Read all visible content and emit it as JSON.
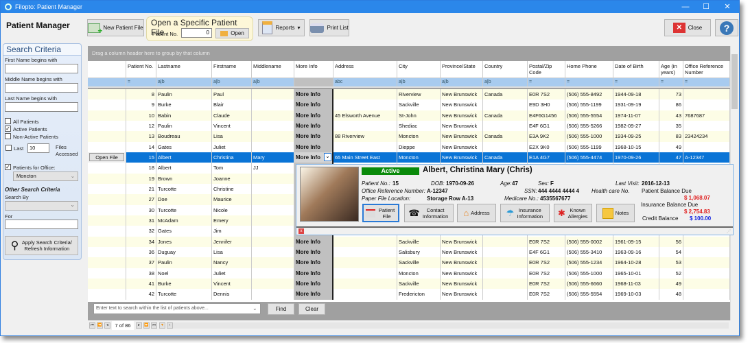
{
  "window": {
    "title": "Filopto: Patient Manager",
    "minimize": "—",
    "maximize": "☐",
    "close": "✕"
  },
  "app_title": "Patient Manager",
  "toolbar": {
    "new_patient": "New Patient File",
    "open_box_title": "Open a Specific Patient File",
    "patient_no_label": "Patient No.",
    "patient_no_value": "0",
    "open": "Open",
    "reports": "Reports",
    "print_list": "Print List",
    "close": "Close",
    "help": "?"
  },
  "search": {
    "title": "Search Criteria",
    "first_name": "First Name begins with",
    "middle_name": "Middle Name begins with",
    "last_name": "Last Name begins with",
    "all_patients": "All Patients",
    "active_patients": "Active Patients",
    "non_active": "Non-Active Patients",
    "last": "Last",
    "last_value": "10",
    "files_accessed": "Files Accessed",
    "patients_for_office": "Patients for Office:",
    "office_value": "Moncton",
    "other": "Other Search Criteria",
    "search_by": "Search By",
    "for": "For",
    "apply": "Apply Search Criteria/ Refresh Information",
    "checked": {
      "all": false,
      "active": true,
      "non_active": false,
      "last": false,
      "office": true
    }
  },
  "grid": {
    "group_hint": "Drag a column header here to group by that column",
    "columns": [
      "",
      "Patient No.",
      "Lastname",
      "Firstname",
      "Middlename",
      "More Info",
      "Address",
      "City",
      "Province/State",
      "Country",
      "Postal/Zip Code",
      "Home Phone",
      "Date of Birth",
      "Age (in years)",
      "Office Reference Number"
    ],
    "filters": [
      "",
      "=",
      "a|b",
      "a|b",
      "a|b",
      "",
      "abc",
      "a|b",
      "a|b",
      "a|b",
      "=",
      "=",
      "=",
      "=",
      "="
    ],
    "open_file": "Open File",
    "selected_row": 6,
    "rows": [
      [
        "8",
        "Paulin",
        "Paul",
        "",
        "More Info",
        "",
        "Riverview",
        "New Brunswick",
        "Canada",
        "E0R 7S2",
        "(506) 555-8492",
        "1944-09-18",
        "73",
        ""
      ],
      [
        "9",
        "Burke",
        "Blair",
        "",
        "More Info",
        "",
        "Sackville",
        "New Brunswick",
        "",
        "E9D 3H0",
        "(506) 555-1199",
        "1931-09-19",
        "86",
        ""
      ],
      [
        "10",
        "Babin",
        "Claude",
        "",
        "More Info",
        "45 Elsworth Avenue",
        "St-John",
        "New Brunswick",
        "Canada",
        "E4F6G1456",
        "(506) 555-5554",
        "1974-11-07",
        "43",
        "7687687"
      ],
      [
        "12",
        "Paulin",
        "Vincent",
        "",
        "More Info",
        "",
        "Shediac",
        "New Brunswick",
        "",
        "E4F 6G1",
        "(506) 555-5266",
        "1982-09-27",
        "35",
        ""
      ],
      [
        "13",
        "Boudreau",
        "Lisa",
        "",
        "More Info",
        "88 Riverview",
        "Moncton",
        "New Brunswick",
        "Canada",
        "E3A 9K2",
        "(506) 555-1000",
        "1934-09-25",
        "83",
        "23424234"
      ],
      [
        "14",
        "Gates",
        "Juliet",
        "",
        "More Info",
        "",
        "Dieppe",
        "New Brunswick",
        "",
        "E2X 9K0",
        "(506) 555-1199",
        "1968-10-15",
        "49",
        ""
      ],
      [
        "15",
        "Albert",
        "Christina",
        "Mary",
        "More Info",
        "65 Main Street East",
        "Moncton",
        "New Brunswick",
        "Canada",
        "E1A 4G7",
        "(506) 555-4474",
        "1970-09-26",
        "47",
        "A-12347"
      ],
      [
        "18",
        "Albert",
        "Tom",
        "JJ",
        "",
        "",
        "",
        "",
        "",
        "",
        "",
        "",
        "",
        ""
      ],
      [
        "19",
        "Brown",
        "Joanne",
        "",
        "",
        "",
        "",
        "",
        "",
        "",
        "",
        "",
        "",
        ""
      ],
      [
        "21",
        "Turcotte",
        "Christine",
        "",
        "",
        "",
        "",
        "",
        "",
        "",
        "",
        "",
        "",
        ""
      ],
      [
        "27",
        "Doe",
        "Maurice",
        "",
        "",
        "",
        "",
        "",
        "",
        "",
        "",
        "",
        "",
        ""
      ],
      [
        "30",
        "Turcotte",
        "Nicole",
        "",
        "",
        "",
        "",
        "",
        "",
        "",
        "",
        "",
        "",
        ""
      ],
      [
        "31",
        "McAdam",
        "Emery",
        "",
        "",
        "",
        "",
        "",
        "",
        "",
        "",
        "",
        "",
        ""
      ],
      [
        "32",
        "Gates",
        "Jim",
        "",
        "",
        "",
        "",
        "",
        "",
        "",
        "",
        "",
        "",
        ""
      ],
      [
        "34",
        "Jones",
        "Jennifer",
        "",
        "More Info",
        "",
        "Sackville",
        "New Brunswick",
        "",
        "E0R 7S2",
        "(506) 555-0002",
        "1961-09-15",
        "56",
        ""
      ],
      [
        "36",
        "Duguay",
        "Lisa",
        "",
        "More Info",
        "",
        "Salisbury",
        "New Brunswick",
        "",
        "E4F 6G1",
        "(506) 555-3410",
        "1963-09-16",
        "54",
        ""
      ],
      [
        "37",
        "Paulin",
        "Nancy",
        "",
        "More Info",
        "",
        "Sackville",
        "New Brunswick",
        "",
        "E0R 7S2",
        "(506) 555-1234",
        "1964-10-28",
        "53",
        ""
      ],
      [
        "38",
        "Noel",
        "Juliet",
        "",
        "More Info",
        "",
        "Moncton",
        "New Brunswick",
        "",
        "E0R 7S2",
        "(506) 555-1000",
        "1965-10-01",
        "52",
        ""
      ],
      [
        "41",
        "Burke",
        "Vincent",
        "",
        "More Info",
        "",
        "Sackville",
        "New Brunswick",
        "",
        "E0R 7S2",
        "(506) 555-6660",
        "1968-11-03",
        "49",
        ""
      ],
      [
        "42",
        "Turcotte",
        "Dennis",
        "",
        "More Info",
        "",
        "Fredericton",
        "New Brunswick",
        "",
        "E0R 7S2",
        "(506) 555-5554",
        "1969-10-03",
        "48",
        ""
      ]
    ]
  },
  "popup": {
    "status": "Active",
    "name": "Albert, Christina Mary (Chris)",
    "patient_no_label": "Patient No.:",
    "patient_no": "15",
    "dob_label": "DOB:",
    "dob": "1970-09-26",
    "age_label": "Age:",
    "age": "47",
    "sex_label": "Sex:",
    "sex": "F",
    "last_visit_label": "Last Visit:",
    "last_visit": "2016-12-13",
    "office_ref_label": "Office Reference Number:",
    "office_ref": "A-12347",
    "ssn_label": "SSN:",
    "ssn": "444 4444 4444 4",
    "health_label": "Health care No.",
    "paper_label": "Paper File Location:",
    "paper": "Storage Row A-13",
    "medicare_label": "Medicare No.:",
    "medicare": "4535567677",
    "patient_balance_label": "Patient Balance Due",
    "patient_balance": "$ 1,068.07",
    "insurance_balance_label": "Insurance Balance Due",
    "insurance_balance": "$ 2,754.83",
    "credit_label": "Credit Balance",
    "credit": "$ 100.00",
    "buttons": [
      "Patient File",
      "Contact Information",
      "Address",
      "Insurance Information",
      "Known Allergies",
      "Notes"
    ],
    "close": "x"
  },
  "bottom": {
    "search_placeholder": "Enter text to search within the list of patients above...",
    "find": "Find",
    "clear": "Clear",
    "page": "7 of 86"
  },
  "colors": {
    "title_bar": "#2b87ea",
    "selected_row": "#0a74d6",
    "active_badge": "#0a8a0a",
    "balance_due": "#e02020",
    "credit": "#1020e0"
  }
}
